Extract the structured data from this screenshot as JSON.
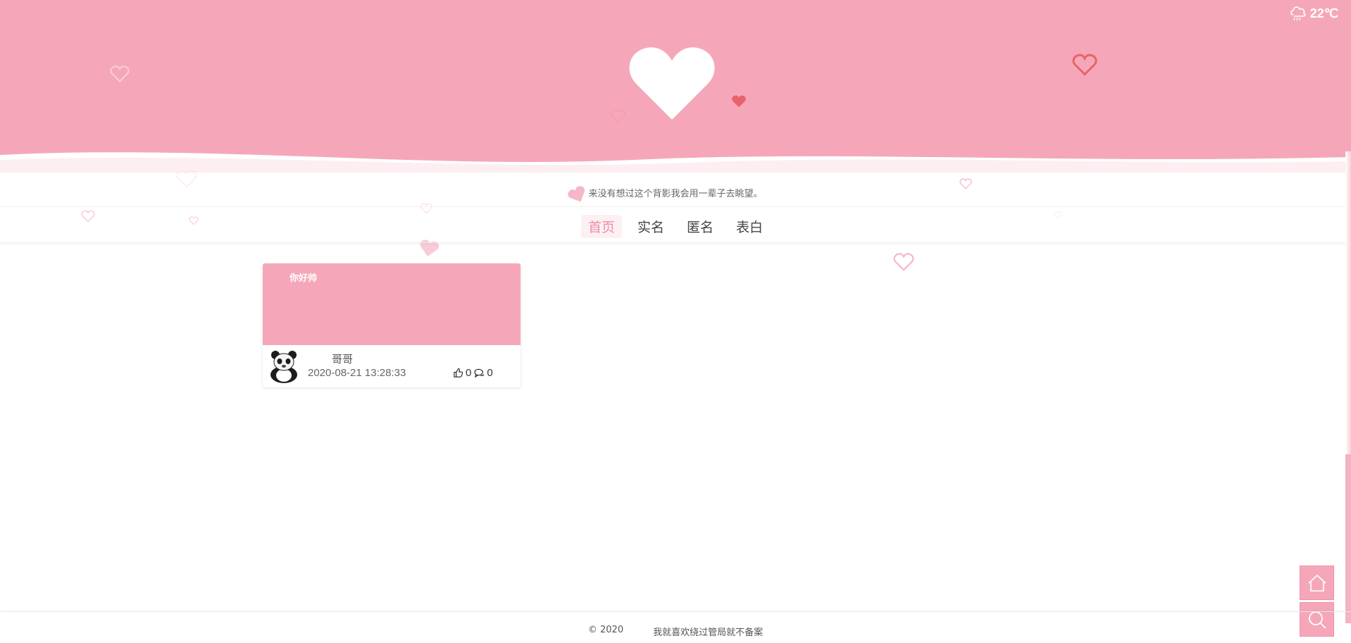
{
  "header": {
    "logo_icon": "heart-icon",
    "weather": {
      "icon": "rain-cloud-icon",
      "temperature": "22℃"
    }
  },
  "tagline": "来没有想过这个背影我会用一辈子去眺望。",
  "nav": {
    "items": [
      {
        "label": "首页",
        "active": true
      },
      {
        "label": "实名",
        "active": false
      },
      {
        "label": "匿名",
        "active": false
      },
      {
        "label": "表白",
        "active": false
      }
    ]
  },
  "posts": [
    {
      "title": "你好帅",
      "author": "哥哥",
      "date": "2020-08-21 13:28:33",
      "likes": "0",
      "comments": "0",
      "avatar_icon": "panda-avatar"
    }
  ],
  "floating_buttons": {
    "home_icon": "home-icon",
    "search_icon": "search-icon"
  },
  "footer": {
    "copyright": "© 2020",
    "note": "我就喜欢绕过管局就不备案"
  },
  "colors": {
    "brand_pink": "#f5a7b9",
    "accent_pink": "#f08ca5",
    "heart_red": "#e9626b"
  }
}
